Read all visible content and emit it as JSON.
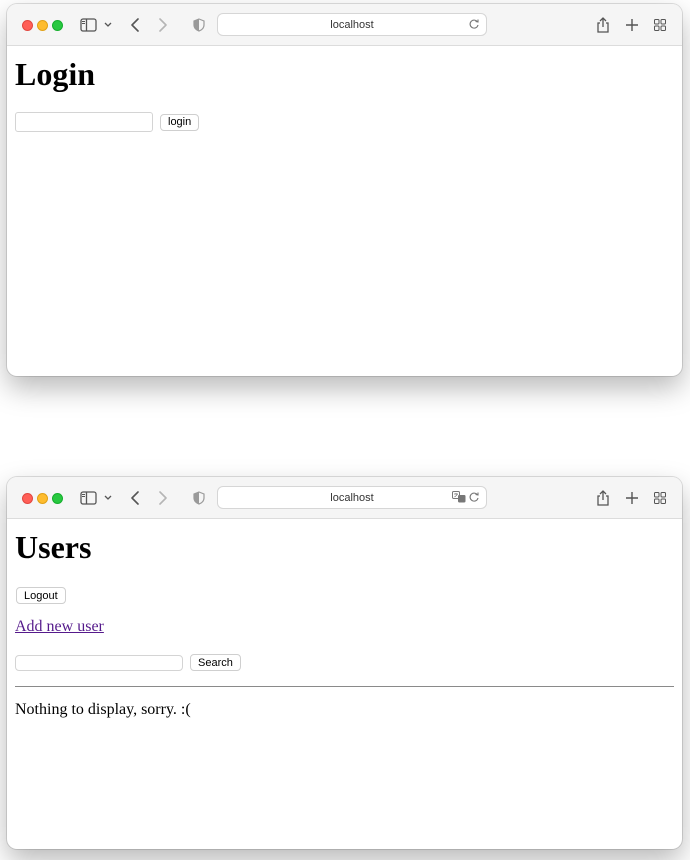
{
  "login_window": {
    "url": "localhost",
    "heading": "Login",
    "input_value": "",
    "login_button_label": "login"
  },
  "users_window": {
    "url": "localhost",
    "heading": "Users",
    "logout_button_label": "Logout",
    "add_user_link": "Add new user",
    "search_value": "",
    "search_button_label": "Search",
    "empty_message": "Nothing to display, sorry. :("
  },
  "colors": {
    "close": "#ff5f57",
    "minimize": "#febc2e",
    "zoom": "#28c840",
    "visited_link": "#551a8b"
  },
  "icons": [
    "sidebar-icon",
    "chevron-down-icon",
    "back-icon",
    "forward-icon",
    "shield-icon",
    "reload-icon",
    "translate-icon",
    "share-icon",
    "new-tab-icon",
    "tab-overview-icon"
  ]
}
